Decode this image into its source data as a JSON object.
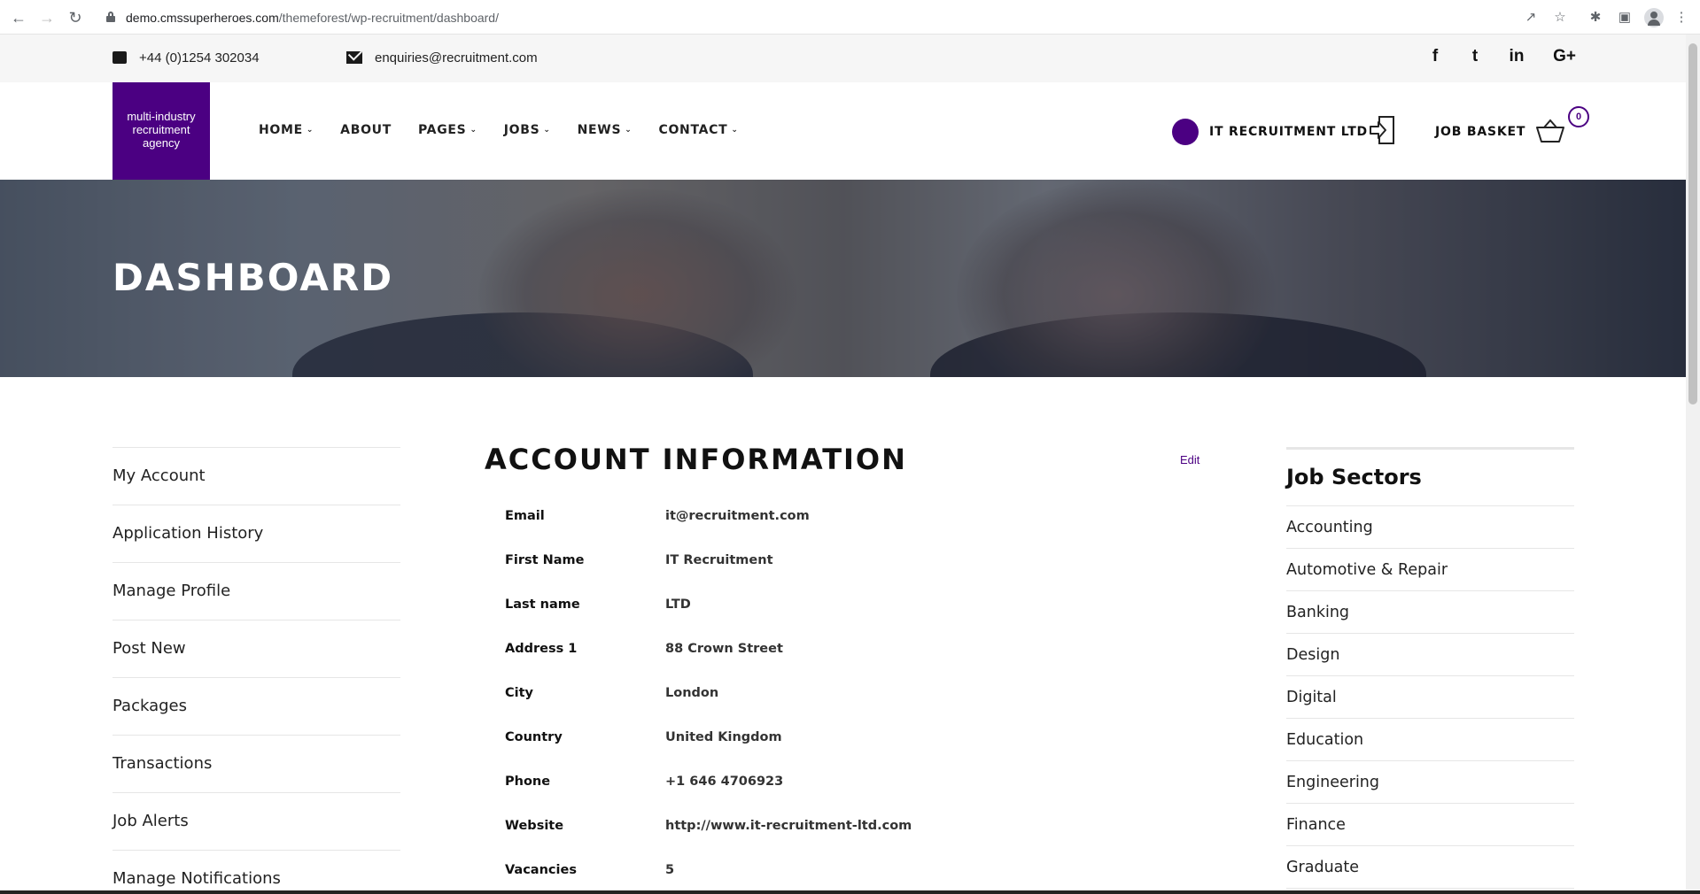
{
  "browser": {
    "url_host": "demo.cmssuperheroes.com",
    "url_path": "/themeforest/wp-recruitment/dashboard/"
  },
  "topbar": {
    "phone": "+44 (0)1254 302034",
    "email": "enquiries@recruitment.com",
    "social": [
      "f",
      "t",
      "in",
      "G+"
    ]
  },
  "header": {
    "logo_text": "multi-industry recruitment agency",
    "menu": [
      {
        "label": "HOME",
        "dropdown": true
      },
      {
        "label": "ABOUT",
        "dropdown": false
      },
      {
        "label": "PAGES",
        "dropdown": true
      },
      {
        "label": "JOBS",
        "dropdown": true
      },
      {
        "label": "NEWS",
        "dropdown": true
      },
      {
        "label": "CONTACT",
        "dropdown": true
      }
    ],
    "company_name": "IT RECRUITMENT LTD",
    "basket_label": "JOB BASKET",
    "basket_count": "0"
  },
  "hero": {
    "title": "DASHBOARD"
  },
  "sidebar": {
    "items": [
      "My Account",
      "Application History",
      "Manage Profile",
      "Post New",
      "Packages",
      "Transactions",
      "Job Alerts",
      "Manage Notifications"
    ]
  },
  "account": {
    "title": "ACCOUNT INFORMATION",
    "edit_label": "Edit",
    "fields": [
      {
        "label": "Email",
        "value": "it@recruitment.com"
      },
      {
        "label": "First Name",
        "value": "IT Recruitment"
      },
      {
        "label": "Last name",
        "value": "LTD"
      },
      {
        "label": "Address 1",
        "value": "88 Crown Street"
      },
      {
        "label": "City",
        "value": "London"
      },
      {
        "label": "Country",
        "value": "United Kingdom"
      },
      {
        "label": "Phone",
        "value": "+1 646 4706923"
      },
      {
        "label": "Website",
        "value": "http://www.it-recruitment-ltd.com"
      },
      {
        "label": "Vacancies",
        "value": "5"
      }
    ]
  },
  "sectors": {
    "title": "Job Sectors",
    "items": [
      "Accounting",
      "Automotive & Repair",
      "Banking",
      "Design",
      "Digital",
      "Education",
      "Engineering",
      "Finance",
      "Graduate"
    ]
  },
  "colors": {
    "brand": "#4b0082"
  }
}
